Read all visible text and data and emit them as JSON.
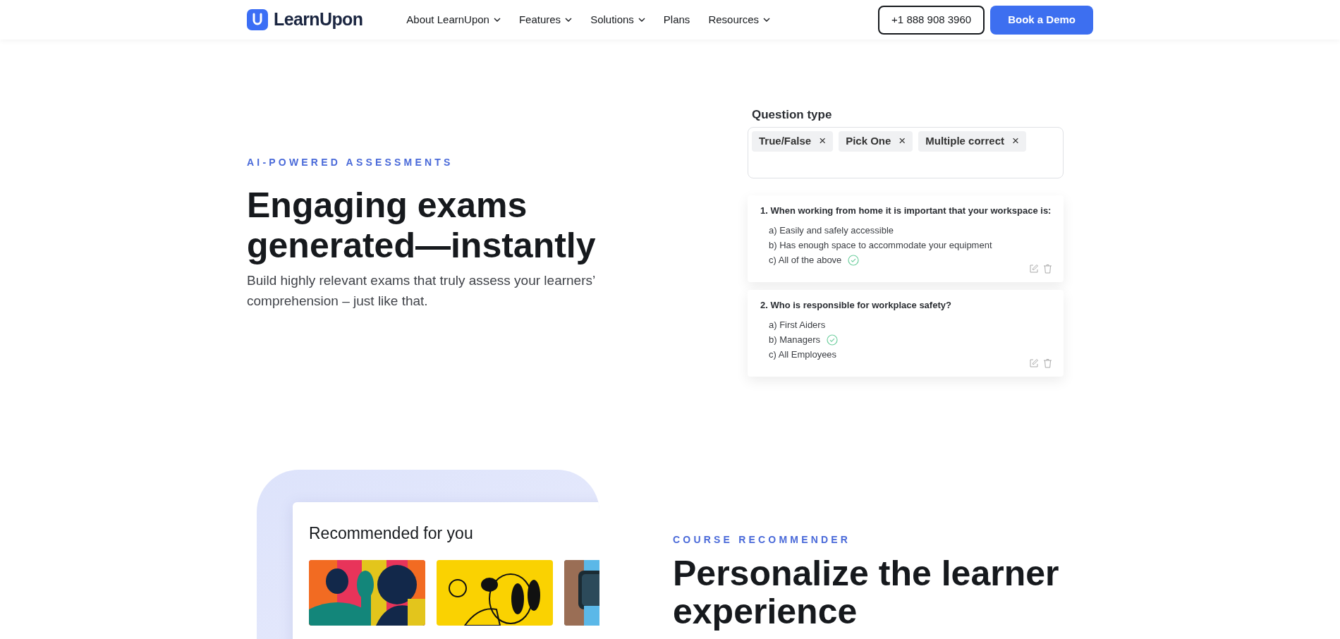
{
  "nav": {
    "logo": "LearnUpon",
    "items": [
      {
        "label": "About LearnUpon",
        "dropdown": true
      },
      {
        "label": "Features",
        "dropdown": true
      },
      {
        "label": "Solutions",
        "dropdown": true
      },
      {
        "label": "Plans",
        "dropdown": false
      },
      {
        "label": "Resources",
        "dropdown": true
      }
    ],
    "phone": "+1 888 908 3960",
    "cta": "Book a Demo"
  },
  "hero": {
    "eyebrow": "AI-POWERED ASSESSMENTS",
    "heading": [
      "Engaging exams",
      "generated—instantly"
    ],
    "text": "Build highly relevant exams that truly assess your learners’ comprehension – just like that."
  },
  "question_type": {
    "label": "Question type",
    "chips": [
      {
        "label": "True/False",
        "remove": "×"
      },
      {
        "label": "Pick One",
        "remove": "×"
      },
      {
        "label": "Multiple correct",
        "remove": "×"
      }
    ]
  },
  "questions": [
    {
      "title": "1. When working from home it is important that your workspace is:",
      "options": [
        {
          "text": "a) Easily and safely accessible",
          "correct": false
        },
        {
          "text": "b) Has enough space to accommodate your equipment",
          "correct": false
        },
        {
          "text": "c) All of the above",
          "correct": true
        }
      ]
    },
    {
      "title": "2. Who is responsible for workplace safety?",
      "options": [
        {
          "text": "a) First Aiders",
          "correct": false
        },
        {
          "text": "b) Managers",
          "correct": true
        },
        {
          "text": "c) All Employees",
          "correct": false
        }
      ]
    }
  ],
  "recommender": {
    "card_title": "Recommended for you",
    "images": [
      {
        "kind": "picture"
      },
      {
        "kind": "picture"
      },
      {
        "kind": "picture"
      }
    ],
    "eyebrow": "COURSE RECOMMENDER",
    "heading": [
      "Personalize the learner",
      "experience"
    ]
  }
}
